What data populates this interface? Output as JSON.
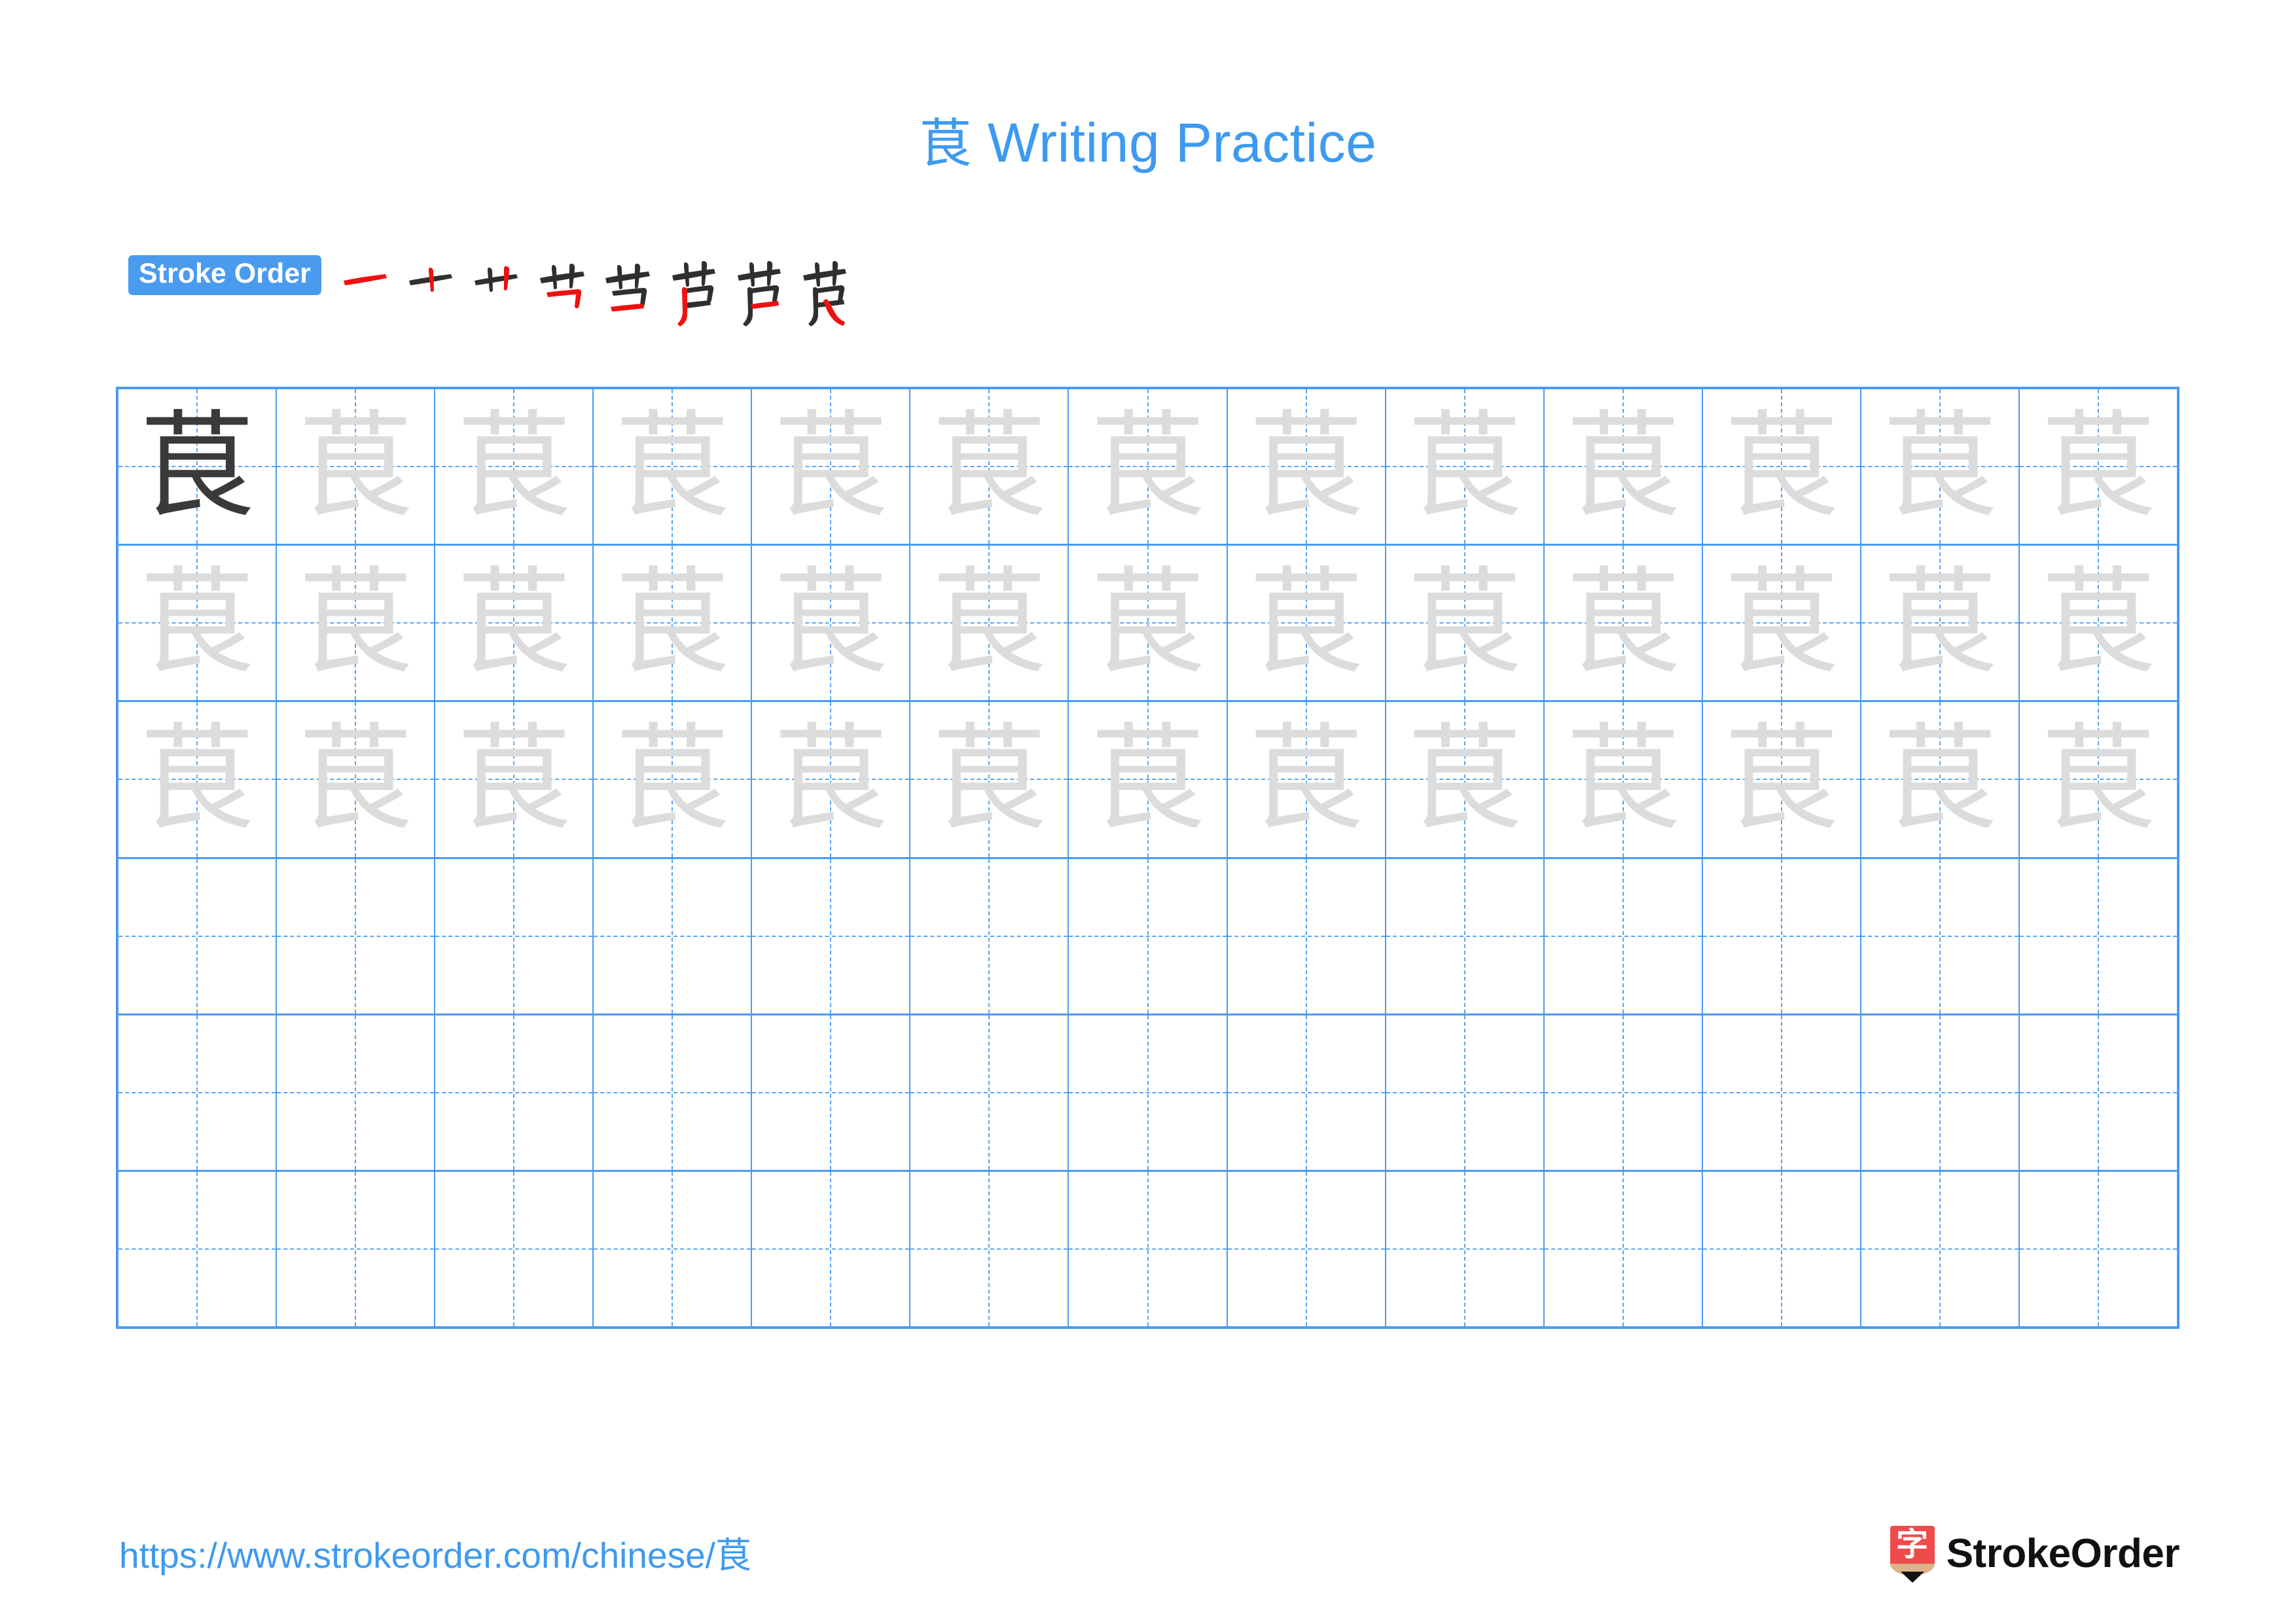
{
  "character": "茛",
  "colors": {
    "accent_blue": "#4a9bf0",
    "title_blue": "#3d9af0",
    "grid_line": "#4a9bf0",
    "guide_dash": "#59a6f2",
    "model_char": "#3a3a3a",
    "trace_char": "#dcdcdc",
    "new_stroke_red": "#ee1111",
    "logo_red": "#f04b4b",
    "logo_wood": "#dbb48c",
    "logo_tip": "#111111"
  },
  "header": {
    "title_character": "茛",
    "title_text": " Writing Practice"
  },
  "stroke_order": {
    "badge_label": "Stroke Order",
    "total_strokes": 8,
    "steps": [
      {
        "index": 1,
        "cumulative_character": "一",
        "new_stroke_name": "heng"
      },
      {
        "index": 2,
        "cumulative_character": "十",
        "new_stroke_name": "shu"
      },
      {
        "index": 3,
        "cumulative_character": "艹",
        "new_stroke_name": "shu"
      },
      {
        "index": 4,
        "cumulative_character": "艼",
        "new_stroke_name": "hengzhe"
      },
      {
        "index": 5,
        "cumulative_character": "芓",
        "new_stroke_name": "heng"
      },
      {
        "index": 6,
        "cumulative_character": "芦",
        "new_stroke_name": "shupie"
      },
      {
        "index": 7,
        "cumulative_character": "芪",
        "new_stroke_name": "heng"
      },
      {
        "index": 8,
        "cumulative_character": "茛",
        "new_stroke_name": "xiegou"
      }
    ]
  },
  "practice_grid": {
    "columns": 13,
    "rows": 6,
    "row_types": [
      "model-and-trace",
      "trace",
      "trace",
      "blank",
      "blank",
      "blank"
    ],
    "rows_data": [
      [
        "茛",
        "茛",
        "茛",
        "茛",
        "茛",
        "茛",
        "茛",
        "茛",
        "茛",
        "茛",
        "茛",
        "茛",
        "茛"
      ],
      [
        "茛",
        "茛",
        "茛",
        "茛",
        "茛",
        "茛",
        "茛",
        "茛",
        "茛",
        "茛",
        "茛",
        "茛",
        "茛"
      ],
      [
        "茛",
        "茛",
        "茛",
        "茛",
        "茛",
        "茛",
        "茛",
        "茛",
        "茛",
        "茛",
        "茛",
        "茛",
        "茛"
      ],
      [
        "",
        "",
        "",
        "",
        "",
        "",
        "",
        "",
        "",
        "",
        "",
        "",
        ""
      ],
      [
        "",
        "",
        "",
        "",
        "",
        "",
        "",
        "",
        "",
        "",
        "",
        "",
        ""
      ],
      [
        "",
        "",
        "",
        "",
        "",
        "",
        "",
        "",
        "",
        "",
        "",
        "",
        ""
      ]
    ],
    "model_cell": {
      "row": 0,
      "column": 0
    }
  },
  "footer": {
    "url_prefix": "https://www.strokeorder.com/chinese/",
    "url_character": "茛",
    "brand_name": "StrokeOrder",
    "logo_glyph": "字"
  }
}
